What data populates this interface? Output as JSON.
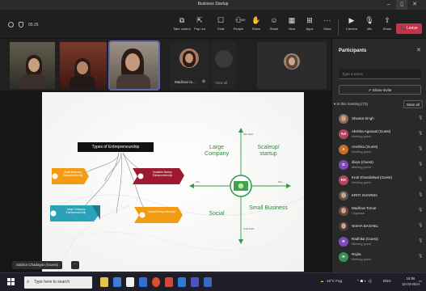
{
  "window": {
    "title": "Business Startup"
  },
  "toolbar": {
    "timer": "05:26",
    "buttons": [
      {
        "label": "Take control",
        "icon": "take-control-icon",
        "glyph": "⧉"
      },
      {
        "label": "Pop out",
        "icon": "pop-out-icon",
        "glyph": "⇱"
      },
      {
        "label": "Chat",
        "icon": "chat-icon",
        "glyph": "☐"
      },
      {
        "label": "People",
        "icon": "people-icon",
        "glyph": "⚇",
        "count": "65"
      },
      {
        "label": "Raise",
        "icon": "raise-hand-icon",
        "glyph": "✋"
      },
      {
        "label": "React",
        "icon": "react-icon",
        "glyph": "☺"
      },
      {
        "label": "View",
        "icon": "view-icon",
        "glyph": "▦"
      },
      {
        "label": "Apps",
        "icon": "apps-icon",
        "glyph": "⊞"
      },
      {
        "label": "More",
        "icon": "more-icon",
        "glyph": "···"
      },
      {
        "label": "Camera",
        "icon": "camera-icon",
        "glyph": "▶"
      },
      {
        "label": "Mic",
        "icon": "mic-icon",
        "glyph": "🎙"
      },
      {
        "label": "Share",
        "icon": "share-icon",
        "glyph": "⇪"
      }
    ],
    "leave_label": "Leave"
  },
  "video_strip": {
    "tiles": [
      {
        "name": "Madhavi Ia...",
        "kind": "avatar-photo"
      },
      {
        "name": "View all",
        "kind": "overflow"
      }
    ]
  },
  "slide": {
    "mindmap_title": "Types of Entrepreneurship",
    "left_nodes": [
      {
        "label": "Small Business Entrepreneurship",
        "color": "#f39c12"
      },
      {
        "label": "Scalable Startup Entrepreneurship",
        "color": "#9b1b30"
      },
      {
        "label": "Large Company Entrepreneurship",
        "color": "#2aa3b8"
      },
      {
        "label": "Social Entrepreneurship",
        "color": "#f39c12"
      }
    ],
    "quadrants": {
      "top_left": "Large Company",
      "top_right": "Scaleup/ startup",
      "bottom_left": "Social",
      "bottom_right": "Small Business"
    },
    "axis_labels": {
      "top": "Fast Scale",
      "bottom": "Profit Scale",
      "left": "Size",
      "right": "Size"
    }
  },
  "presenter": {
    "name": "Sabina Chadayan (Guest)",
    "more": "···"
  },
  "participants": {
    "title": "Participants",
    "search_placeholder": "Type a name",
    "share_invite": "Share invite",
    "meeting_header": "In this meeting (73)",
    "mute_all": "Mute all",
    "list": [
      {
        "name": "Shweta Singh",
        "role": "",
        "initials": "",
        "color": "#8a6d5c",
        "photo": true
      },
      {
        "name": "Akshita Agarwal (Guest)",
        "role": "Meeting guest",
        "initials": "AA",
        "color": "#b6465f"
      },
      {
        "name": "Anshika (Guest)",
        "role": "Meeting guest",
        "initials": "A",
        "color": "#c36e2f"
      },
      {
        "name": "divya (Guest)",
        "role": "Meeting guest",
        "initials": "D",
        "color": "#7c4bb8"
      },
      {
        "name": "Kruti Khandelwal (Guest)",
        "role": "Meeting guest",
        "initials": "KK",
        "color": "#b6465f"
      },
      {
        "name": "KRITI SHARMA",
        "role": "",
        "initials": "",
        "color": "#555",
        "photo": true
      },
      {
        "name": "Madhavi Tomar",
        "role": "Organizer",
        "initials": "",
        "color": "#6b4a3c",
        "photo": true
      },
      {
        "name": "NISHA BAGHEL",
        "role": "",
        "initials": "",
        "color": "#4a3a3a",
        "photo": true
      },
      {
        "name": "Radhika (Guest)",
        "role": "Meeting guest",
        "initials": "R",
        "color": "#7c4bb8"
      },
      {
        "name": "Rajita",
        "role": "Meeting guest",
        "initials": "R",
        "color": "#3b8f5a"
      }
    ]
  },
  "taskbar": {
    "search_placeholder": "Type here to search",
    "weather": "18°C Fog",
    "lang": "ENG",
    "time": "16:56",
    "date": "16-03-2024"
  }
}
